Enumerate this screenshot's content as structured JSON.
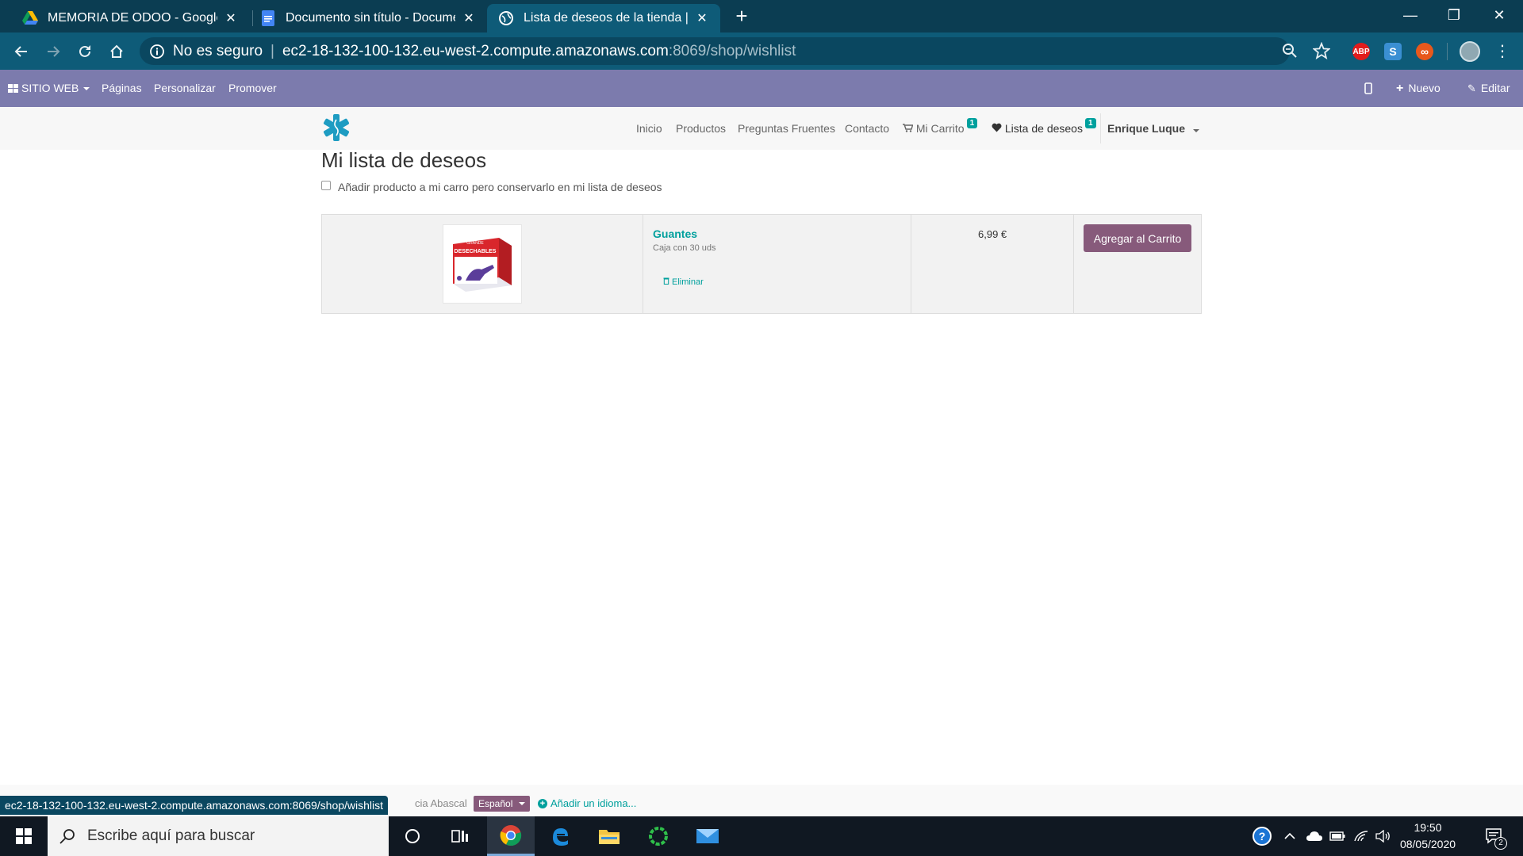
{
  "browser": {
    "tabs": [
      {
        "title": "MEMORIA DE ODOO - Google D",
        "icon": "google-drive-icon",
        "active": false
      },
      {
        "title": "Documento sin título - Documen",
        "icon": "google-docs-icon",
        "active": false
      },
      {
        "title": "Lista de deseos de la tienda | My",
        "icon": "globe-icon",
        "active": true
      }
    ],
    "new_tab": "+",
    "security_label": "No es seguro",
    "url_host": "ec2-18-132-100-132.eu-west-2.compute.amazonaws.com",
    "url_path": ":8069/shop/wishlist",
    "extensions": [
      "ABP",
      "S",
      "∞"
    ]
  },
  "odoo_bar": {
    "site_menu": "SITIO WEB",
    "pages": "Páginas",
    "customize": "Personalizar",
    "promote": "Promover",
    "new": "Nuevo",
    "edit": "Editar"
  },
  "site_nav": {
    "links": [
      "Inicio",
      "Productos",
      "Preguntas Fruentes",
      "Contacto"
    ],
    "cart_label": "Mi Carrito",
    "cart_count": "1",
    "wishlist_label": "Lista de deseos",
    "wishlist_count": "1",
    "user": "Enrique Luque"
  },
  "page": {
    "title": "Mi lista de deseos",
    "keep_checkbox_label": "Añadir producto a mi carro pero conservarlo en mi lista de deseos",
    "items": [
      {
        "name": "Guantes",
        "description": "Caja con 30 uds",
        "remove_label": "Eliminar",
        "price": "6,99 €",
        "add_to_cart_label": "Agregar al Carrito",
        "image_text_top": "GRANDE",
        "image_text_main": "DESECHABLES"
      }
    ]
  },
  "footer": {
    "status_url": "ec2-18-132-100-132.eu-west-2.compute.amazonaws.com:8069/shop/wishlist",
    "faded_text": "cia Abascal",
    "language": "Español",
    "add_language": "Añadir un idioma..."
  },
  "taskbar": {
    "search_placeholder": "Escribe aquí para buscar",
    "time": "19:50",
    "date": "08/05/2020",
    "notifications": "2"
  },
  "colors": {
    "odoo_purple": "#7c7bad",
    "accent_teal": "#00a09d",
    "button_purple": "#875a7b",
    "chrome_dark": "#0b3d52"
  }
}
